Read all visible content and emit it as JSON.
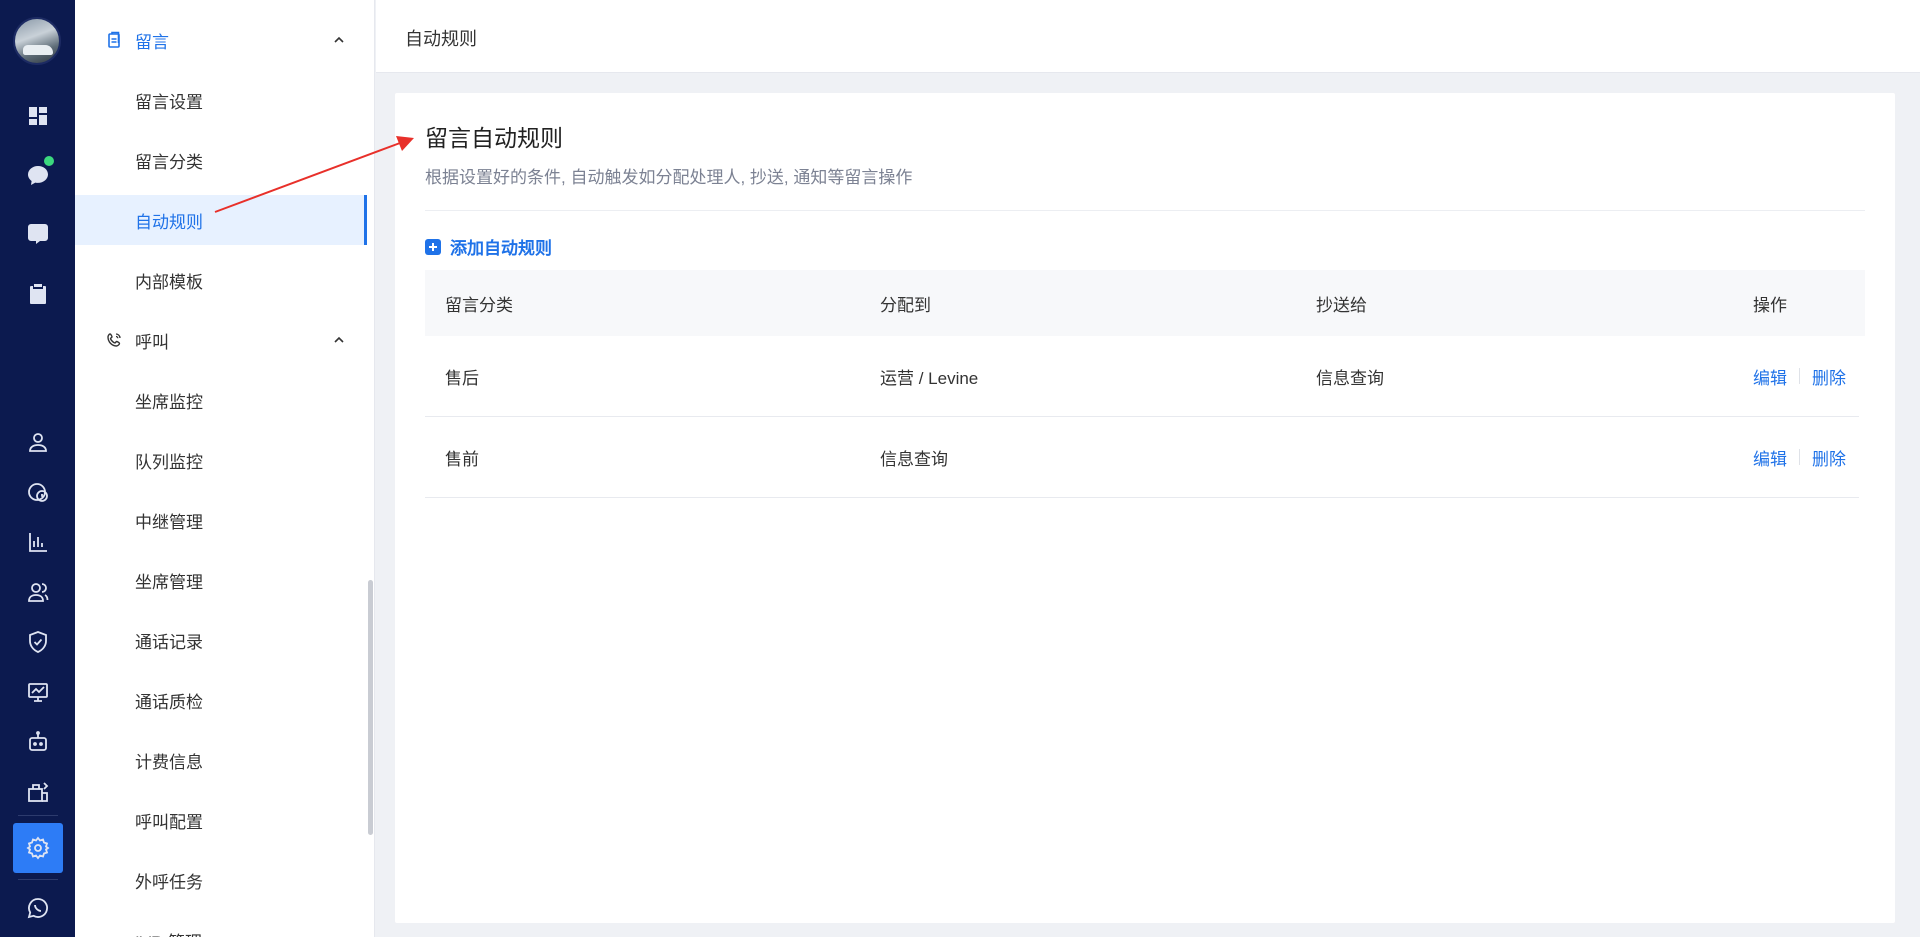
{
  "rail": {
    "icons": [
      "dashboard-icon",
      "chat-icon",
      "phone-icon",
      "clipboard-icon",
      "user-icon",
      "history-icon",
      "bar-chart-icon",
      "users-icon",
      "shield-icon",
      "monitor-chart-icon",
      "robot-icon",
      "package-icon",
      "settings-icon",
      "whatsapp-icon"
    ],
    "accent": "#2d7cf6",
    "online_dot": "#3cd87e"
  },
  "sidebar": {
    "group1": {
      "label": "留言",
      "icon": "message-file-icon"
    },
    "group1_items": [
      {
        "label": "留言设置"
      },
      {
        "label": "留言分类"
      },
      {
        "label": "自动规则",
        "active": true
      },
      {
        "label": "内部模板"
      }
    ],
    "group2": {
      "label": "呼叫",
      "icon": "phone-call-icon"
    },
    "group2_items": [
      {
        "label": "坐席监控"
      },
      {
        "label": "队列监控"
      },
      {
        "label": "中继管理"
      },
      {
        "label": "坐席管理"
      },
      {
        "label": "通话记录"
      },
      {
        "label": "通话质检"
      },
      {
        "label": "计费信息"
      },
      {
        "label": "呼叫配置"
      },
      {
        "label": "外呼任务"
      },
      {
        "label": "IVR 管理"
      }
    ]
  },
  "header": {
    "breadcrumb": "自动规则"
  },
  "main": {
    "title": "留言自动规则",
    "description": "根据设置好的条件, 自动触发如分配处理人, 抄送, 通知等留言操作",
    "add_button": "添加自动规则",
    "columns": [
      "留言分类",
      "分配到",
      "抄送给",
      "操作"
    ],
    "rows": [
      {
        "category": "售后",
        "assign": "运营 / Levine",
        "cc": "信息查询",
        "edit": "编辑",
        "delete": "删除"
      },
      {
        "category": "售前",
        "assign": "信息查询",
        "cc": "",
        "edit": "编辑",
        "delete": "删除"
      }
    ]
  },
  "colors": {
    "primary": "#1f72e8",
    "rail_bg": "#0c1a4f",
    "annotation_arrow": "#e8302a"
  }
}
